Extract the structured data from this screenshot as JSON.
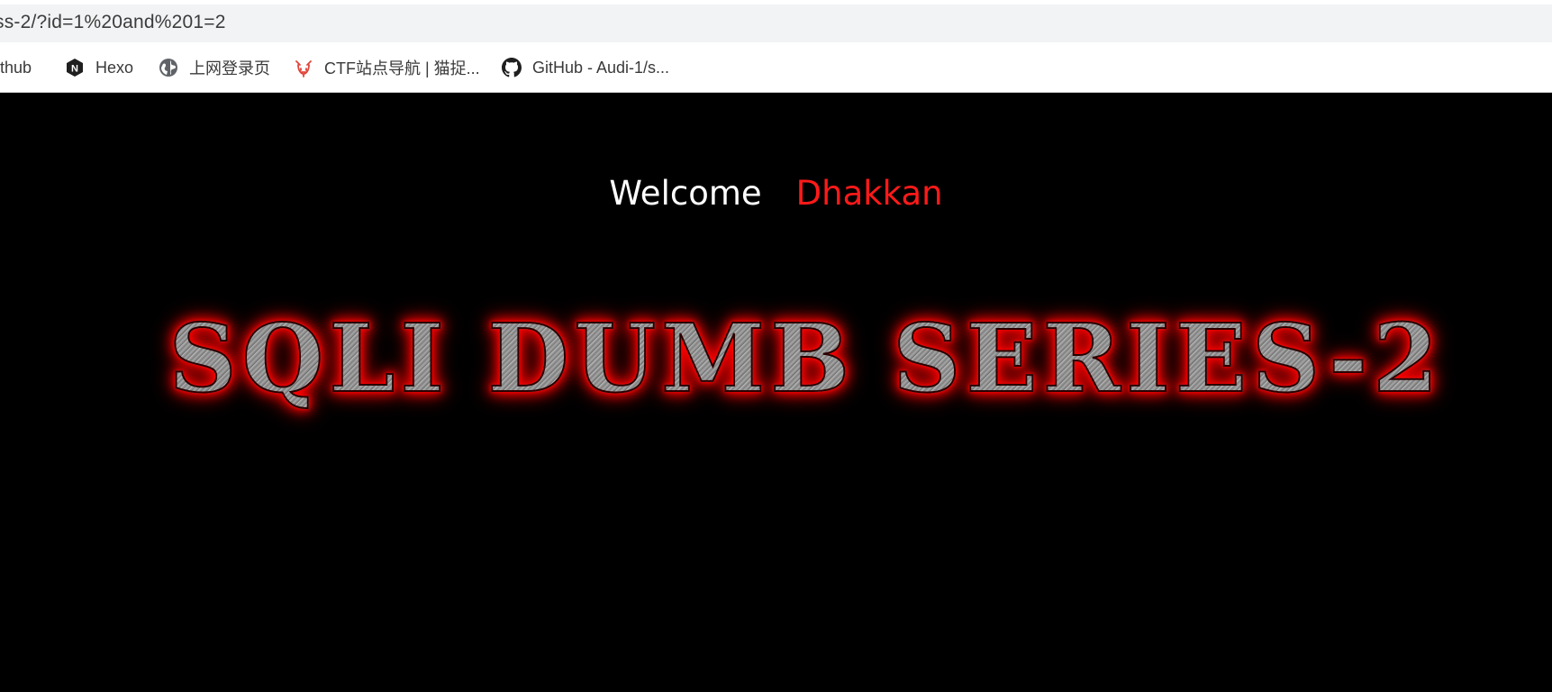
{
  "browser": {
    "address_text": "ss-2/?id=1%20and%201=2",
    "bookmarks": [
      {
        "label": "ithub",
        "icon": "none"
      },
      {
        "label": "Hexo",
        "icon": "hexo-icon"
      },
      {
        "label": "上网登录页",
        "icon": "globe-icon"
      },
      {
        "label": "CTF站点导航 | 猫捉...",
        "icon": "cat-icon"
      },
      {
        "label": "GitHub - Audi-1/s...",
        "icon": "github-icon"
      }
    ]
  },
  "page": {
    "welcome_label": "Welcome",
    "user_name": "Dhakkan",
    "banner_text": "SQLI DUMB SERIES-2",
    "colors": {
      "background": "#000000",
      "welcome": "#ffffff",
      "name": "#ff1a1a",
      "banner_glow": "#ff0000"
    }
  }
}
